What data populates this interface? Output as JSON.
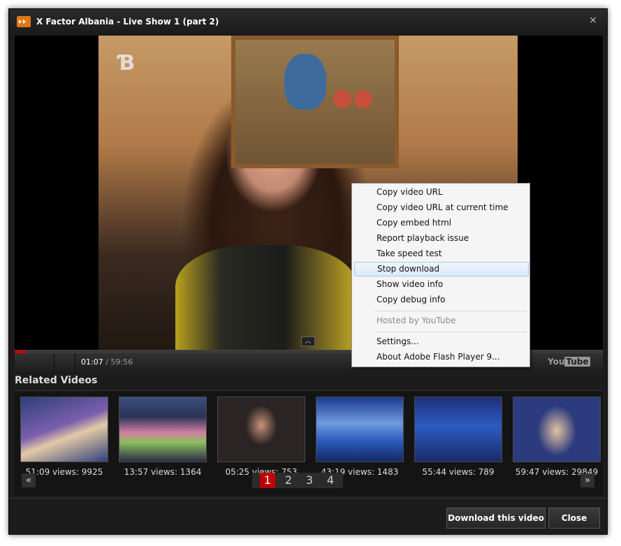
{
  "window": {
    "title": "X Factor Albania - Live Show 1 (part 2)",
    "close_glyph": "×"
  },
  "player": {
    "current_time": "01:07",
    "separator": " / ",
    "duration": "59:56",
    "progress_fraction": 0.019,
    "channel_logo": "Ɓ",
    "youtube_logo_left": "You",
    "youtube_logo_right": "Tube",
    "expand_glyph": "︿"
  },
  "context_menu": {
    "items": [
      {
        "label": "Copy video URL"
      },
      {
        "label": "Copy video URL at current time"
      },
      {
        "label": "Copy embed html"
      },
      {
        "label": "Report playback issue"
      },
      {
        "label": "Take speed test"
      },
      {
        "label": "Stop download",
        "highlighted": true
      },
      {
        "label": "Show video info"
      },
      {
        "label": "Copy debug info"
      },
      {
        "label": "Hosted by YouTube",
        "disabled": true
      },
      {
        "label": "Settings..."
      },
      {
        "label": "About Adobe Flash Player 9..."
      }
    ]
  },
  "related": {
    "title": "Related Videos",
    "videos": [
      {
        "caption": "51:09 views: 9925"
      },
      {
        "caption": "13:57 views: 1364"
      },
      {
        "caption": "05:25 views: 753"
      },
      {
        "caption": "43:19 views: 1483"
      },
      {
        "caption": "55:44 views: 789"
      },
      {
        "caption": "59:47 views: 29849"
      }
    ],
    "prev": "«",
    "next": "»",
    "pages": [
      "1",
      "2",
      "3",
      "4"
    ],
    "current_page": 1
  },
  "footer": {
    "download_label": "Download this video",
    "close_label": "Close"
  },
  "colors": {
    "accent": "#c00000",
    "menu_bg": "#f5f5f5",
    "window_bg": "#1c1c1c"
  }
}
